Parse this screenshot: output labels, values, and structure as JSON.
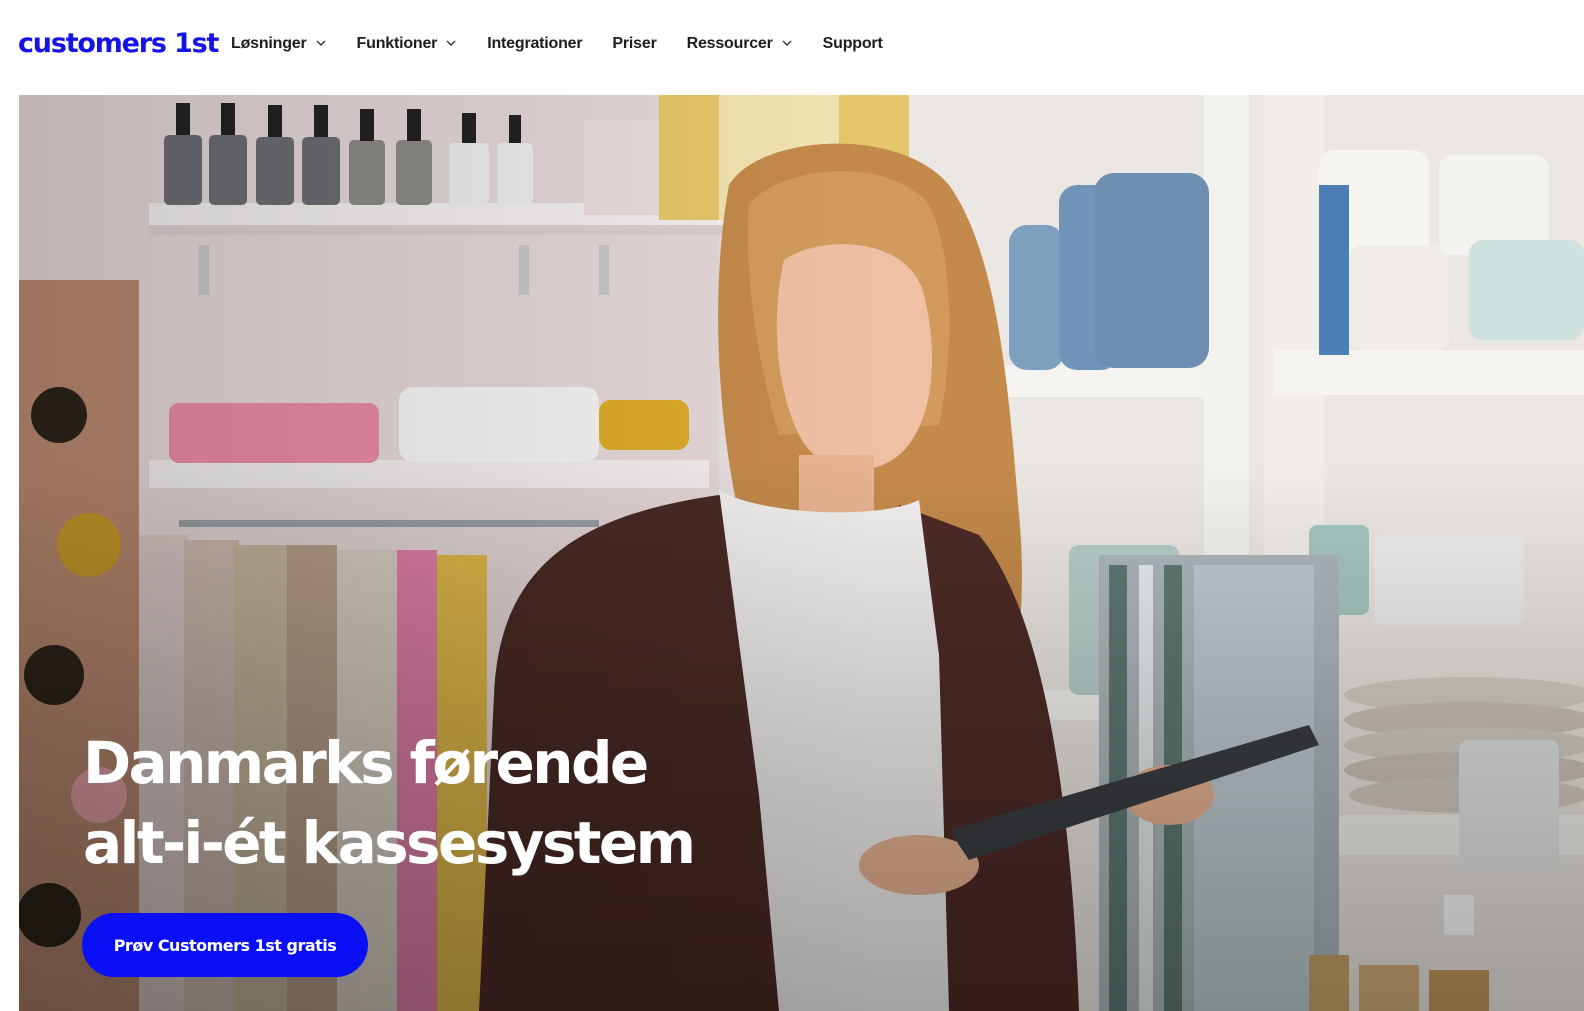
{
  "brand": {
    "logo_text": "customers 1st",
    "color": "#1414e6"
  },
  "nav": {
    "items": [
      {
        "label": "Løsninger",
        "dropdown": true,
        "icon": "chevron-down-icon"
      },
      {
        "label": "Funktioner",
        "dropdown": true,
        "icon": "chevron-down-icon"
      },
      {
        "label": "Integrationer",
        "dropdown": false
      },
      {
        "label": "Priser",
        "dropdown": false
      },
      {
        "label": "Ressourcer",
        "dropdown": true,
        "icon": "chevron-down-icon"
      },
      {
        "label": "Support",
        "dropdown": false
      }
    ]
  },
  "hero": {
    "title_line1": "Danmarks førende",
    "title_line2": "alt-i-ét kassesystem",
    "cta_label": "Prøv Customers 1st gratis",
    "cta_color": "#0a0ff5",
    "image": "woman-with-tablet-in-retail-store"
  }
}
